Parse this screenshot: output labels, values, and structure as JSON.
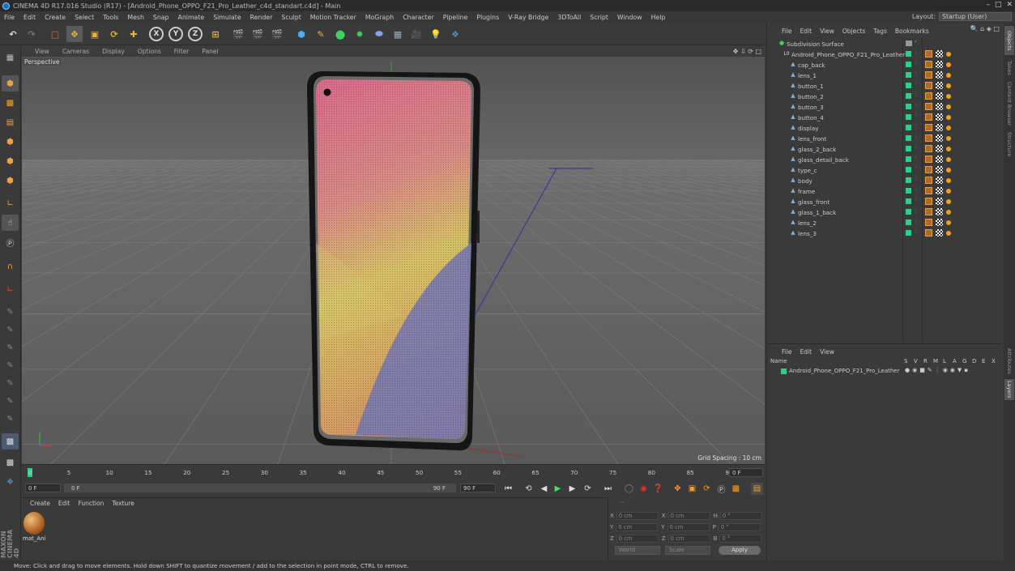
{
  "window": {
    "title": "CINEMA 4D R17.016 Studio (R17) - [Android_Phone_OPPO_F21_Pro_Leather_c4d_standart.c4d] - Main"
  },
  "menu": [
    "File",
    "Edit",
    "Create",
    "Select",
    "Tools",
    "Mesh",
    "Snap",
    "Animate",
    "Simulate",
    "Render",
    "Sculpt",
    "Motion Tracker",
    "MoGraph",
    "Character",
    "Pipeline",
    "Plugins",
    "V-Ray Bridge",
    "3DToAll",
    "Script",
    "Window",
    "Help"
  ],
  "layout": {
    "label": "Layout:",
    "value": "Startup (User)"
  },
  "viewport": {
    "menu": [
      "View",
      "Cameras",
      "Display",
      "Options",
      "Filter",
      "Panel"
    ],
    "label": "Perspective",
    "grid_spacing": "Grid Spacing : 10 cm"
  },
  "timeline": {
    "ticks": [
      "0",
      "5",
      "10",
      "15",
      "20",
      "25",
      "30",
      "35",
      "40",
      "45",
      "50",
      "55",
      "60",
      "65",
      "70",
      "75",
      "80",
      "85",
      "90"
    ],
    "current_frame": "0 F"
  },
  "playback": {
    "start": "0 F",
    "range_start": "0 F",
    "range_end": "90 F",
    "end": "90 F"
  },
  "material_panel": {
    "menu": [
      "Create",
      "Edit",
      "Function",
      "Texture"
    ],
    "material_name": "mat_Ani"
  },
  "coordinates": {
    "rows": [
      {
        "a": "X",
        "av": "0 cm",
        "b": "X",
        "bv": "0 cm",
        "c": "H",
        "cv": "0 °"
      },
      {
        "a": "Y",
        "av": "0 cm",
        "b": "Y",
        "bv": "0 cm",
        "c": "P",
        "cv": "0 °"
      },
      {
        "a": "Z",
        "av": "0 cm",
        "b": "Z",
        "bv": "0 cm",
        "c": "B",
        "cv": "0 °"
      }
    ],
    "mode1": "World",
    "mode2": "Scale",
    "apply": "Apply",
    "header": "--"
  },
  "object_manager": {
    "menu": [
      "File",
      "Edit",
      "View",
      "Objects",
      "Tags",
      "Bookmarks"
    ],
    "objects": [
      "Subdivision Surface",
      "Android_Phone_OPPO_F21_Pro_Leather",
      "cap_back",
      "lens_1",
      "button_1",
      "button_2",
      "button_3",
      "button_4",
      "display",
      "lens_front",
      "glass_2_back",
      "glass_detail_back",
      "type_c",
      "body",
      "frame",
      "glass_front",
      "glass_1_back",
      "lens_2",
      "lens_3"
    ]
  },
  "attribute_manager": {
    "menu": [
      "File",
      "Edit",
      "View"
    ],
    "columns": [
      "Name",
      "S",
      "V",
      "R",
      "M",
      "L",
      "A",
      "G",
      "D",
      "E",
      "X"
    ],
    "row_name": "Android_Phone_OPPO_F21_Pro_Leather"
  },
  "right_tabs": [
    "Objects",
    "Takes",
    "Content Browser",
    "Structure",
    "Attributes",
    "Layers"
  ],
  "status": "Move: Click and drag to move elements. Hold down SHIFT to quantize movement / add to the selection in point mode, CTRL to remove.",
  "colors": {
    "accent_green": "#2fcf8a",
    "axis_x": "#e04040",
    "axis_y": "#40c040",
    "axis_z": "#4060e0"
  }
}
